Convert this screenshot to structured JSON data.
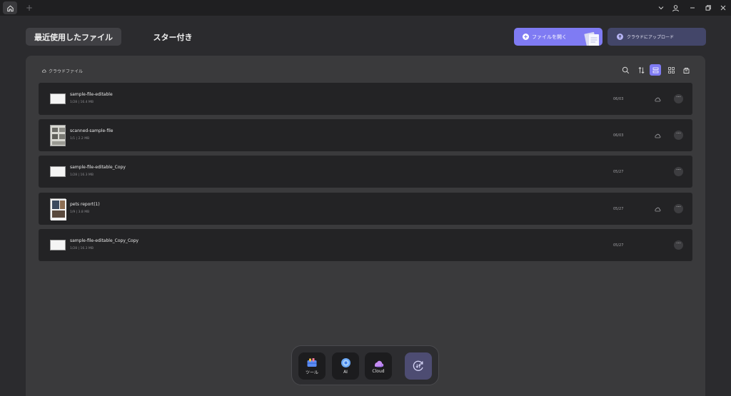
{
  "titlebar": {
    "new_tab_label": "+"
  },
  "tabs": {
    "recent": "最近使用したファイル",
    "starred": "スター付き"
  },
  "actions": {
    "open_file": "ファイルを開く",
    "upload_cloud": "クラウドにアップロード"
  },
  "breadcrumb": {
    "label": "クラウドファイル",
    "icon": "cloud-icon"
  },
  "toolbar": {
    "icons": [
      "search-icon",
      "sort-icon",
      "list-view-icon",
      "grid-view-icon",
      "cart-icon"
    ],
    "active": "list-view-icon",
    "accent": "#7f7bf3"
  },
  "files": [
    {
      "name": "sample-file-editable",
      "meta": "1/28 | 16.4 MB",
      "date": "06/03",
      "cloud": true
    },
    {
      "name": "scanned-sample-file",
      "meta": "1/1 | 2.2 MB",
      "date": "06/03",
      "cloud": true
    },
    {
      "name": "sample-file-editable_Copy",
      "meta": "1/28 | 16.3 MB",
      "date": "05/27",
      "cloud": false
    },
    {
      "name": "pets report(1)",
      "meta": "1/9 | 3.8 MB",
      "date": "05/27",
      "cloud": true
    },
    {
      "name": "sample-file-editable_Copy_Copy",
      "meta": "1/28 | 16.3 MB",
      "date": "05/27",
      "cloud": false
    }
  ],
  "more_label": "···",
  "dock": {
    "tools": "ツール",
    "ai": "AI",
    "cloud": "Cloud"
  }
}
